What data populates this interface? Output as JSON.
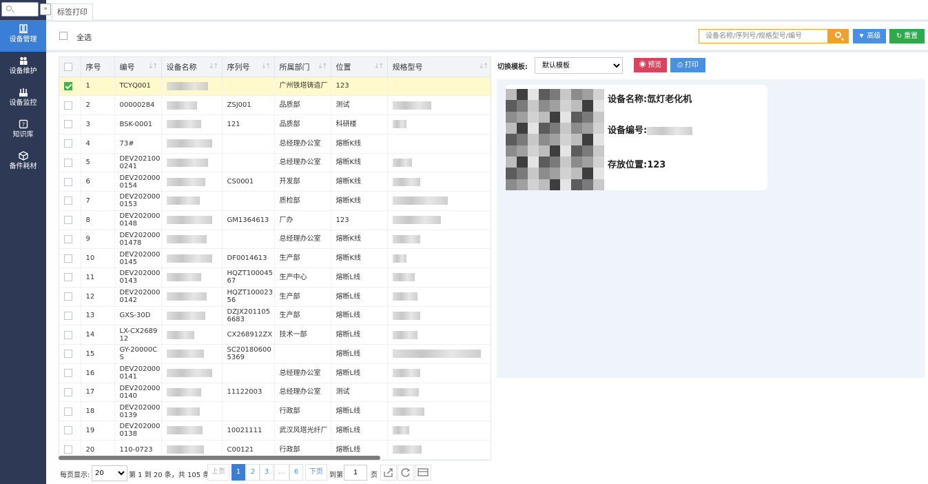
{
  "sidebar": {
    "items": [
      {
        "label": "设备管理",
        "icon": "book-icon",
        "active": true
      },
      {
        "label": "设备维护",
        "icon": "people-icon",
        "active": false
      },
      {
        "label": "设备监控",
        "icon": "monitor-icon",
        "active": false
      },
      {
        "label": "知识库",
        "icon": "question-icon",
        "active": false
      },
      {
        "label": "备件耗材",
        "icon": "cube-icon",
        "active": false
      }
    ]
  },
  "tab": {
    "label": "标签打印"
  },
  "toolbar": {
    "select_all": "全选",
    "search_placeholder": "设备名称/序列号/规格型号/编号",
    "advanced": "高级",
    "reset": "重置"
  },
  "table": {
    "columns": [
      "序号",
      "编号",
      "设备名称",
      "序列号",
      "所属部门",
      "位置",
      "规格型号"
    ],
    "rows": [
      {
        "no": "1",
        "code": "TCYQ001",
        "serial": "",
        "dept": "广州铁塔铸造厂",
        "loc": "123",
        "checked": true
      },
      {
        "no": "2",
        "code": "00000284",
        "serial": "ZSJ001",
        "dept": "品质部",
        "loc": "测试",
        "checked": false
      },
      {
        "no": "3",
        "code": "BSK-0001",
        "serial": "121",
        "dept": "品质部",
        "loc": "科研楼",
        "checked": false
      },
      {
        "no": "4",
        "code": "73#",
        "serial": "",
        "dept": "总经理办公室",
        "loc": "熔断K线",
        "checked": false
      },
      {
        "no": "5",
        "code": "DEV2021000241",
        "serial": "",
        "dept": "总经理办公室",
        "loc": "熔断K线",
        "checked": false
      },
      {
        "no": "6",
        "code": "DEV2020000154",
        "serial": "CS0001",
        "dept": "开发部",
        "loc": "熔断K线",
        "checked": false
      },
      {
        "no": "7",
        "code": "DEV2020000153",
        "serial": "",
        "dept": "质检部",
        "loc": "熔断K线",
        "checked": false
      },
      {
        "no": "8",
        "code": "DEV2020000148",
        "serial": "GM1364613",
        "dept": "厂办",
        "loc": "123",
        "checked": false
      },
      {
        "no": "9",
        "code": "DEV20200001478",
        "serial": "",
        "dept": "总经理办公室",
        "loc": "熔断K线",
        "checked": false
      },
      {
        "no": "10",
        "code": "DEV2020000145",
        "serial": "DF0014613",
        "dept": "生产部",
        "loc": "熔断K线",
        "checked": false
      },
      {
        "no": "11",
        "code": "DEV2020000143",
        "serial": "HQZT10004567",
        "dept": "生产中心",
        "loc": "熔断L线",
        "checked": false
      },
      {
        "no": "12",
        "code": "DEV2020000142",
        "serial": "HQZT10002356",
        "dept": "生产部",
        "loc": "熔断L线",
        "checked": false
      },
      {
        "no": "13",
        "code": "GXS-30D",
        "serial": "DZJX2011056683",
        "dept": "生产部",
        "loc": "熔断L线",
        "checked": false
      },
      {
        "no": "14",
        "code": "LX-CX268912",
        "serial": "CX268912ZX",
        "dept": "技术一部",
        "loc": "熔断L线",
        "checked": false
      },
      {
        "no": "15",
        "code": "GY-20000CS",
        "serial": "SC201806005369",
        "dept": "",
        "loc": "熔断L线",
        "checked": false
      },
      {
        "no": "16",
        "code": "DEV2020000141",
        "serial": "",
        "dept": "总经理办公室",
        "loc": "熔断L线",
        "checked": false
      },
      {
        "no": "17",
        "code": "DEV2020000140",
        "serial": "11122003",
        "dept": "总经理办公室",
        "loc": "测试",
        "checked": false
      },
      {
        "no": "18",
        "code": "DEV2020000139",
        "serial": "",
        "dept": "行政部",
        "loc": "熔断L线",
        "checked": false
      },
      {
        "no": "19",
        "code": "DEV2020000138",
        "serial": "10021111",
        "dept": "武汉风塔光纤厂",
        "loc": "熔断L线",
        "checked": false
      },
      {
        "no": "20",
        "code": "110-0723",
        "serial": "C00121",
        "dept": "行政部",
        "loc": "熔断L线",
        "checked": false
      }
    ]
  },
  "pager": {
    "per_page_label": "每页显示:",
    "per_page": "20",
    "summary": "第 1 到 20 条，共 105 条",
    "prev": "上页",
    "pages": [
      "1",
      "2",
      "3",
      "...",
      "6"
    ],
    "current": "1",
    "next": "下页",
    "goto_label": "到第",
    "goto_value": "1",
    "page_unit": "页"
  },
  "preview": {
    "template_label": "切换模板:",
    "template_value": "默认模板",
    "preview_btn": "预览",
    "print_btn": "打印",
    "name_line": "设备名称:氙灯老化机",
    "code_line": "设备编号:",
    "location_line": "存放位置:123"
  },
  "colors": {
    "sidebar": "#2e3a55",
    "active": "#3a7fd5",
    "search": "#f0a030",
    "reset": "#2faa4a",
    "preview": "#d9435d"
  }
}
